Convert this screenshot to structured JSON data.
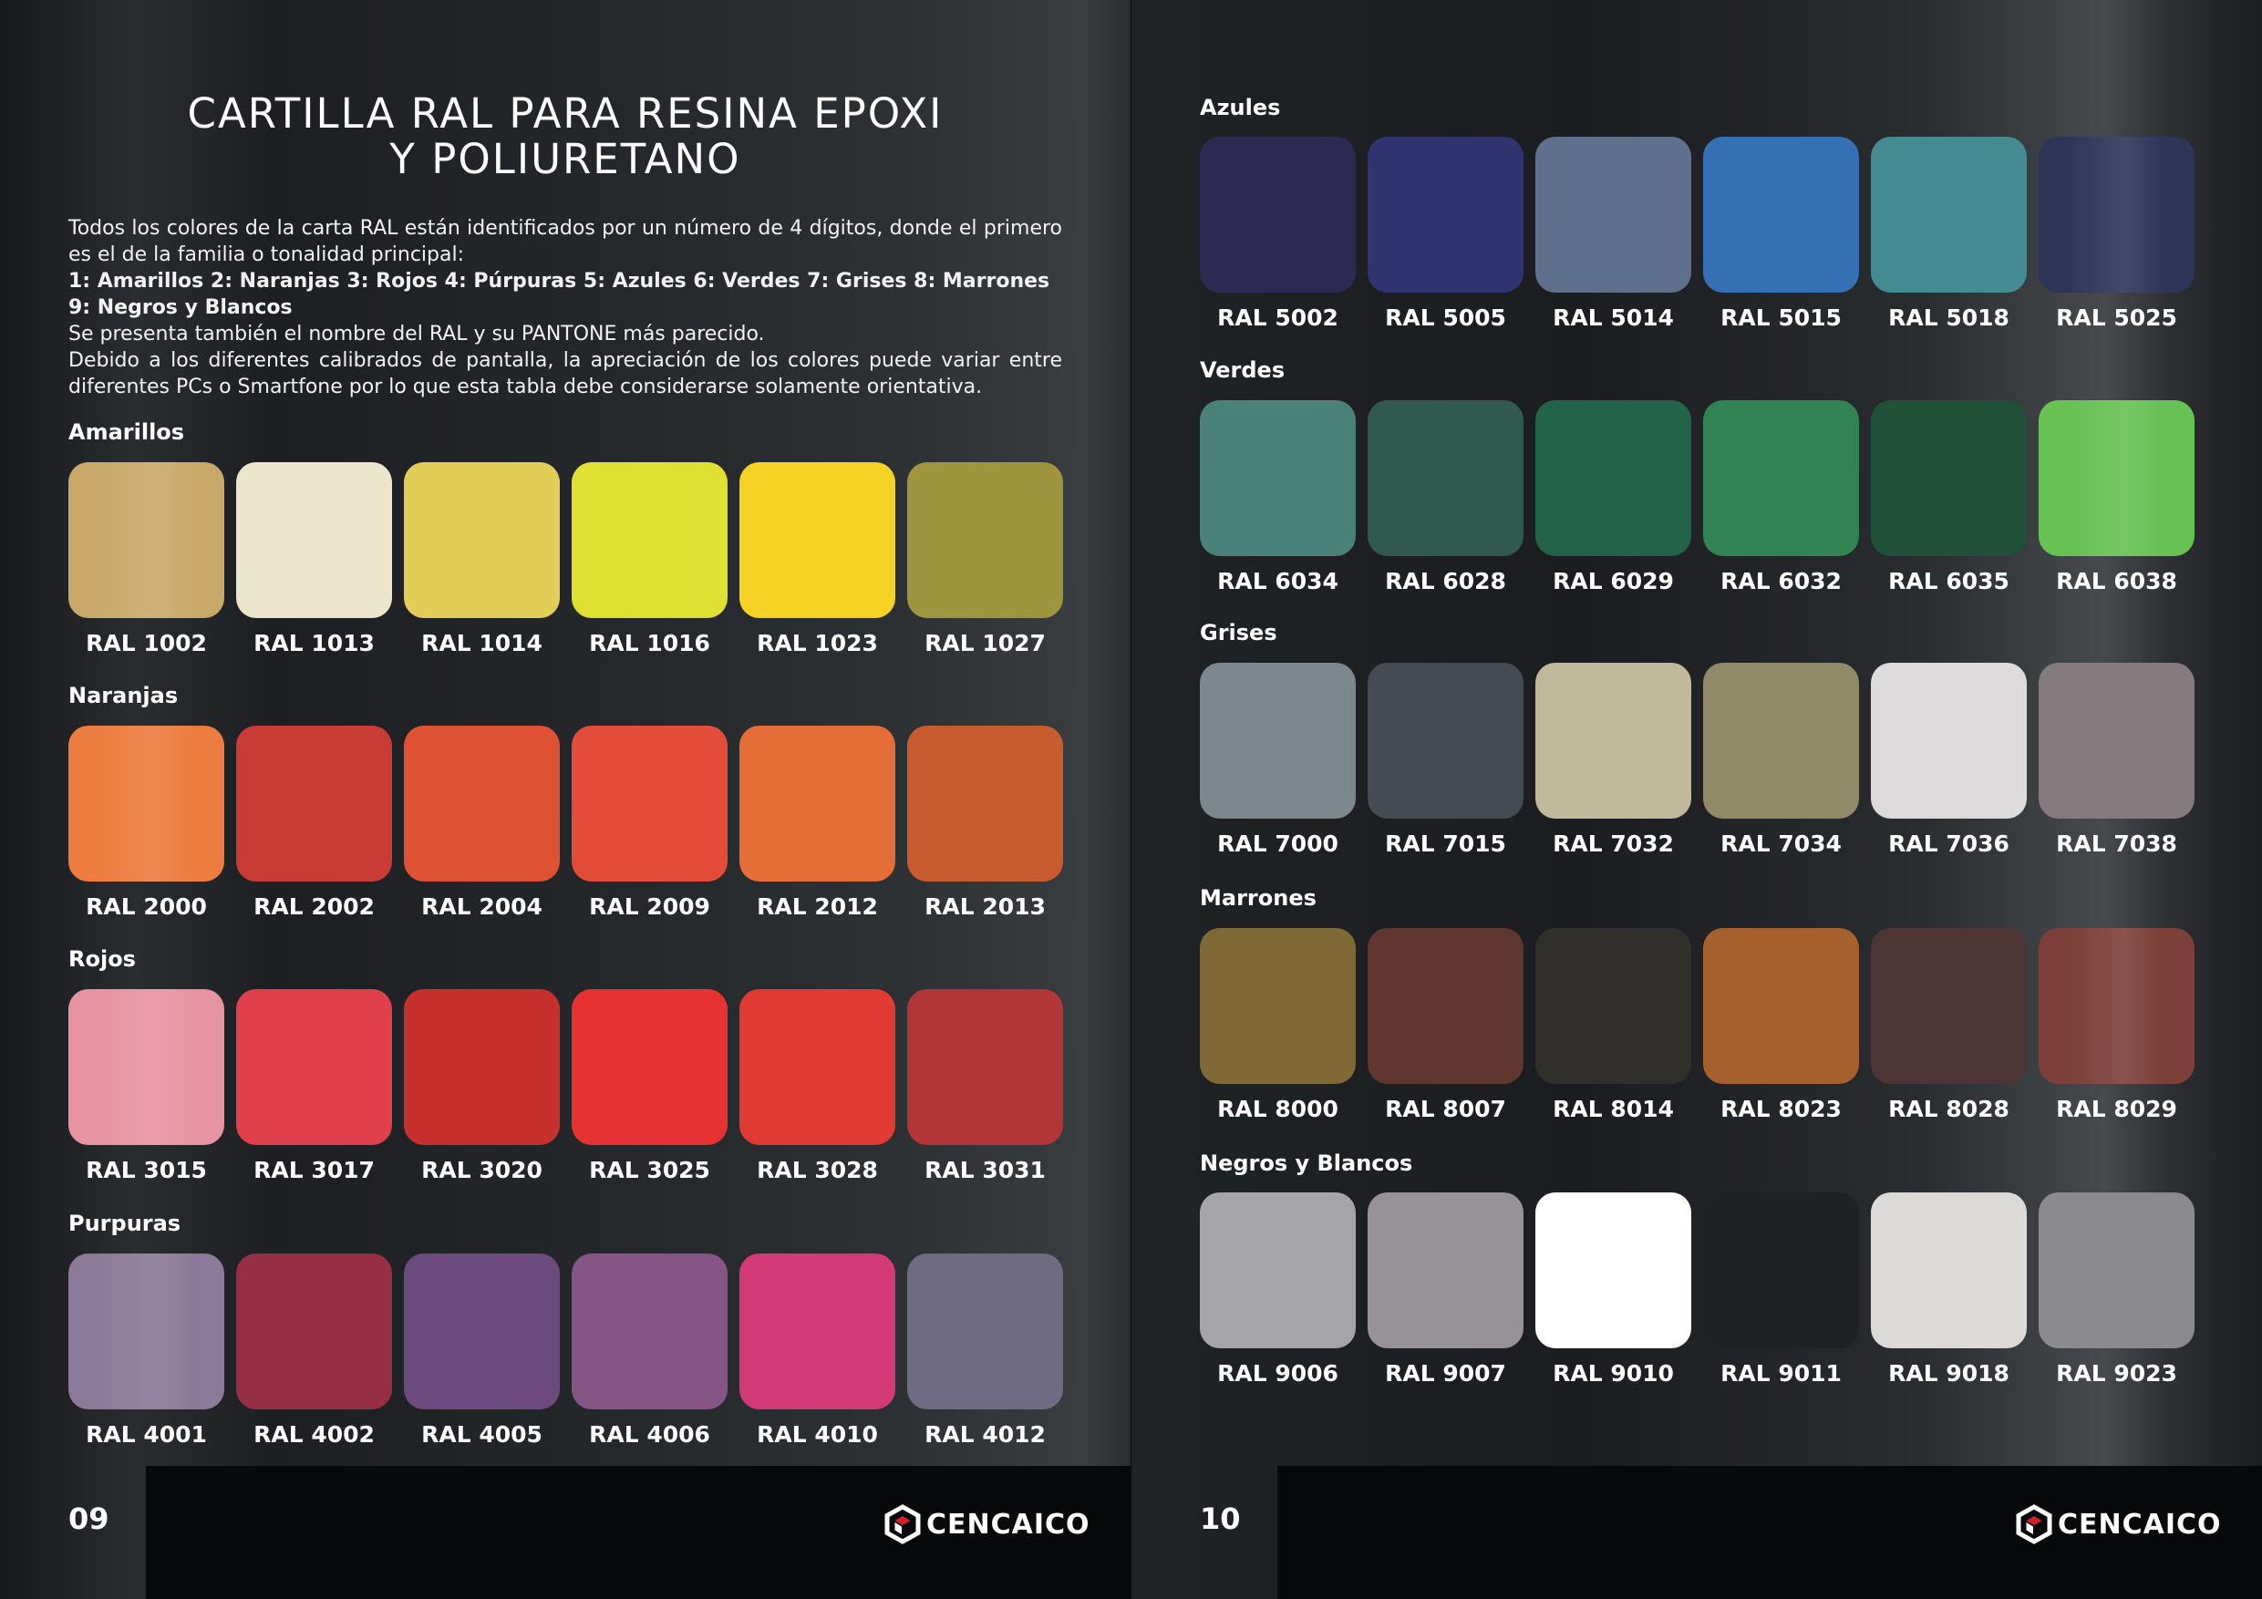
{
  "left_page": {
    "title_line1": "CARTILLA RAL PARA RESINA EPOXI",
    "title_line2": "Y POLIURETANO",
    "intro_line1": "Todos los colores de la carta RAL están identificados por un número de 4 dígitos, donde el primero es el de la familia o tonalidad principal:",
    "intro_families": "1: Amarillos 2: Naranjas 3: Rojos 4: Púrpuras 5: Azules 6: Verdes 7: Grises 8: Marrones 9: Negros y Blancos",
    "intro_line3": "Se presenta también el nombre del RAL y su PANTONE más parecido.",
    "intro_line4": "Debido a los diferentes calibrados de pantalla, la apreciación de los colores puede variar entre diferentes PCs o Smartfone por lo que esta tabla debe considerarse solamente orientativa.",
    "page_number": "09",
    "brand": "CENCAICO"
  },
  "right_page": {
    "page_number": "10",
    "brand": "CENCAICO"
  },
  "sections": [
    {
      "title": "Amarillos",
      "swatches": [
        {
          "code": "RAL 1002",
          "color": "#c8a96a"
        },
        {
          "code": "RAL 1013",
          "color": "#ebe5cc"
        },
        {
          "code": "RAL 1014",
          "color": "#e2cd57"
        },
        {
          "code": "RAL 1016",
          "color": "#e0e033"
        },
        {
          "code": "RAL 1023",
          "color": "#f5d223"
        },
        {
          "code": "RAL 1027",
          "color": "#a0953f"
        }
      ]
    },
    {
      "title": "Naranjas",
      "swatches": [
        {
          "code": "RAL 2000",
          "color": "#ec7c3f"
        },
        {
          "code": "RAL 2002",
          "color": "#c93c35"
        },
        {
          "code": "RAL 2004",
          "color": "#de5133"
        },
        {
          "code": "RAL 2009",
          "color": "#e44c3a"
        },
        {
          "code": "RAL 2012",
          "color": "#e56d37"
        },
        {
          "code": "RAL 2013",
          "color": "#c95c2f"
        }
      ]
    },
    {
      "title": "Rojos",
      "swatches": [
        {
          "code": "RAL 3015",
          "color": "#e893a2"
        },
        {
          "code": "RAL 3017",
          "color": "#e0404c"
        },
        {
          "code": "RAL 3020",
          "color": "#c8302e"
        },
        {
          "code": "RAL 3025",
          "color": "#e63233"
        },
        {
          "code": "RAL 3028",
          "color": "#e13a33"
        },
        {
          "code": "RAL 3031",
          "color": "#b23537"
        }
      ]
    },
    {
      "title": "Purpuras",
      "swatches": [
        {
          "code": "RAL 4001",
          "color": "#8b7a99"
        },
        {
          "code": "RAL 4002",
          "color": "#962f45"
        },
        {
          "code": "RAL 4005",
          "color": "#6c4a7d"
        },
        {
          "code": "RAL 4006",
          "color": "#855586"
        },
        {
          "code": "RAL 4010",
          "color": "#d53a78"
        },
        {
          "code": "RAL 4012",
          "color": "#6e6b83"
        }
      ]
    },
    {
      "title": "Azules",
      "swatches": [
        {
          "code": "RAL 5002",
          "color": "#2c2a52"
        },
        {
          "code": "RAL 5005",
          "color": "#2f3470"
        },
        {
          "code": "RAL 5014",
          "color": "#5f708c"
        },
        {
          "code": "RAL 5015",
          "color": "#3570b4"
        },
        {
          "code": "RAL 5018",
          "color": "#458b92"
        },
        {
          "code": "RAL 5025",
          "color": "#2e3557"
        }
      ]
    },
    {
      "title": "Verdes",
      "swatches": [
        {
          "code": "RAL 6034",
          "color": "#4a8178"
        },
        {
          "code": "RAL 6028",
          "color": "#31594d"
        },
        {
          "code": "RAL 6029",
          "color": "#22634a"
        },
        {
          "code": "RAL 6032",
          "color": "#318354"
        },
        {
          "code": "RAL 6035",
          "color": "#22513a"
        },
        {
          "code": "RAL 6038",
          "color": "#67c153"
        }
      ]
    },
    {
      "title": "Grises",
      "swatches": [
        {
          "code": "RAL 7000",
          "color": "#7c878e"
        },
        {
          "code": "RAL 7015",
          "color": "#464a52"
        },
        {
          "code": "RAL 7032",
          "color": "#c0b99c"
        },
        {
          "code": "RAL 7034",
          "color": "#908a69"
        },
        {
          "code": "RAL 7036",
          "color": "#dddadb"
        },
        {
          "code": "RAL 7038",
          "color": "#857b7f"
        }
      ]
    },
    {
      "title": "Marrones",
      "swatches": [
        {
          "code": "RAL 8000",
          "color": "#7f6a37"
        },
        {
          "code": "RAL 8007",
          "color": "#603631"
        },
        {
          "code": "RAL 8014",
          "color": "#312f2c"
        },
        {
          "code": "RAL 8023",
          "color": "#a6602e"
        },
        {
          "code": "RAL 8028",
          "color": "#4d3535"
        },
        {
          "code": "RAL 8029",
          "color": "#7c3f39"
        }
      ]
    },
    {
      "title": "Negros y Blancos",
      "swatches": [
        {
          "code": "RAL 9006",
          "color": "#a5a4a6"
        },
        {
          "code": "RAL 9007",
          "color": "#969295"
        },
        {
          "code": "RAL 9010",
          "color": "#ffffff"
        },
        {
          "code": "RAL 9011",
          "color": "#1e2223"
        },
        {
          "code": "RAL 9018",
          "color": "#dcd9d9"
        },
        {
          "code": "RAL 9023",
          "color": "#8b8a8d"
        }
      ]
    }
  ]
}
